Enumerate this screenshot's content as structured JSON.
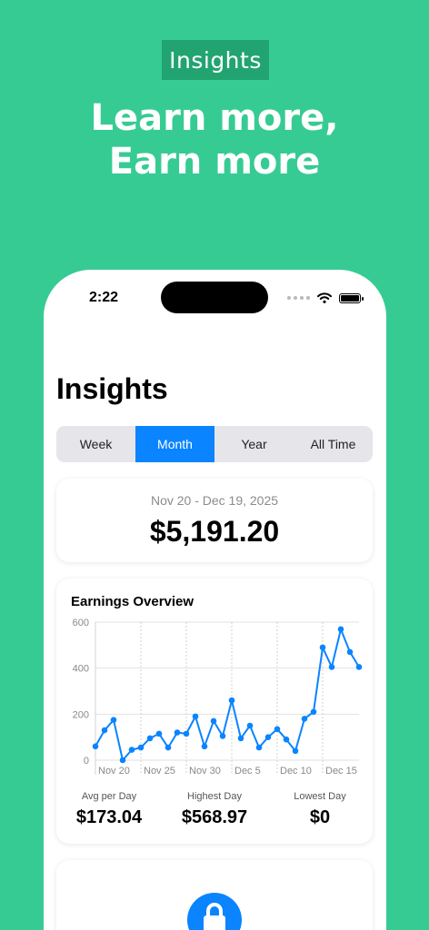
{
  "promo": {
    "badge": "Insights",
    "headline_line1": "Learn more,",
    "headline_line2": "Earn more"
  },
  "status_bar": {
    "time": "2:22"
  },
  "screen": {
    "title": "Insights",
    "tabs": [
      {
        "label": "Week",
        "selected": false
      },
      {
        "label": "Month",
        "selected": true
      },
      {
        "label": "Year",
        "selected": false
      },
      {
        "label": "All Time",
        "selected": false
      }
    ],
    "date_range": "Nov 20 - Dec 19, 2025",
    "total": "$5,191.20"
  },
  "chart_title": "Earnings Overview",
  "chart_data": {
    "type": "line",
    "title": "Earnings Overview",
    "x": [
      1,
      2,
      3,
      4,
      5,
      6,
      7,
      8,
      9,
      10,
      11,
      12,
      13,
      14,
      15,
      16,
      17,
      18,
      19,
      20,
      21,
      22,
      23,
      24,
      25,
      26,
      27,
      28,
      29,
      30
    ],
    "values": [
      60,
      130,
      175,
      0,
      45,
      55,
      95,
      115,
      55,
      120,
      115,
      190,
      60,
      170,
      105,
      260,
      95,
      150,
      55,
      100,
      135,
      90,
      40,
      180,
      210,
      490,
      405,
      568.97,
      470,
      405
    ],
    "xtick_labels": [
      "Nov 20",
      "Nov 25",
      "Nov 30",
      "Dec 5",
      "Dec 10",
      "Dec 15"
    ],
    "xtick_positions": [
      1,
      6,
      11,
      16,
      21,
      26
    ],
    "yticks": [
      0,
      200,
      400,
      600
    ],
    "ylim": [
      0,
      600
    ],
    "grid": true,
    "color": "#0A84FF"
  },
  "stats": [
    {
      "label": "Avg per Day",
      "value": "$173.04"
    },
    {
      "label": "Highest Day",
      "value": "$568.97"
    },
    {
      "label": "Lowest Day",
      "value": "$0"
    }
  ],
  "icons": {
    "lock": "lock-icon",
    "wifi": "wifi-icon",
    "battery": "battery-icon"
  }
}
